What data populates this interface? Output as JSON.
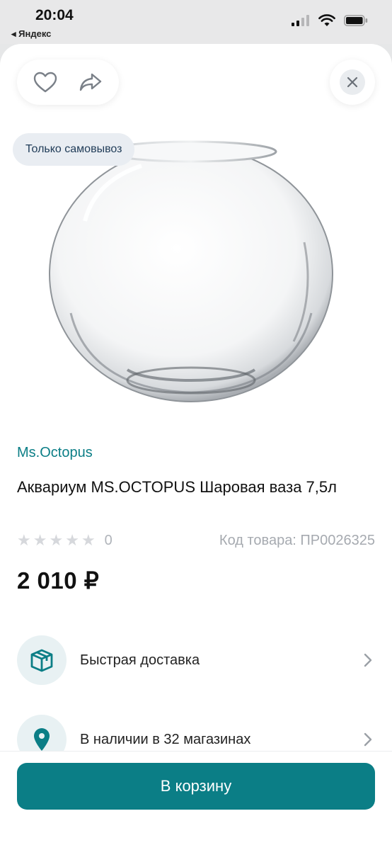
{
  "status_bar": {
    "time": "20:04",
    "back_app": "◂ Яндекс"
  },
  "badge": "Только самовывоз",
  "product": {
    "brand": "Ms.Octopus",
    "title": "Аквариум MS.OCTOPUS Шаровая ваза 7,5л",
    "rating_count": "0",
    "rating_value": 0,
    "sku": "Код товара: ПР0026325",
    "price": "2 010 ₽"
  },
  "options": [
    {
      "label": "Быстрая доставка",
      "icon": "box-icon"
    },
    {
      "label": "В наличии в 32 магазинах",
      "icon": "location-pin-icon"
    }
  ],
  "cart_button": "В корзину",
  "colors": {
    "accent": "#0b7e86",
    "badge_bg": "#e9edf2",
    "icon_bg": "#e8f1f3"
  }
}
